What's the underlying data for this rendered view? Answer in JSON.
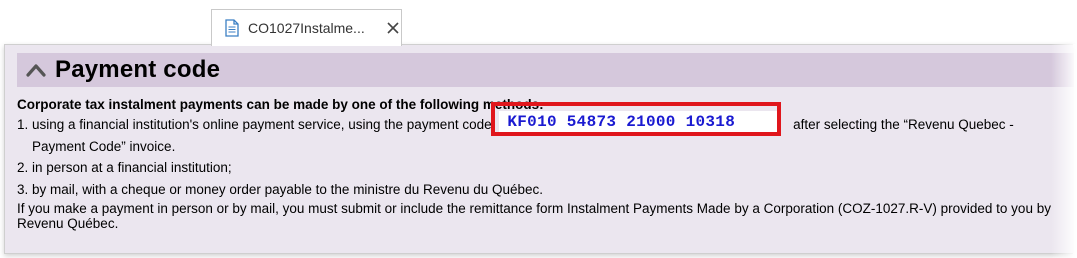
{
  "tab": {
    "title": "CO1027Instalme...",
    "file_icon": "document-icon",
    "close_icon": "close-icon"
  },
  "section": {
    "title": "Payment code",
    "toggle_icon": "chevron-up-icon"
  },
  "content": {
    "intro": "Corporate tax instalment payments can be made by one of the following methods:",
    "method1_prefix": "1. using a financial institution's online payment service, using the payment code",
    "payment_code": "KF010  54873  21000  10318",
    "method1_suffix": "after selecting the “Revenu Quebec -",
    "method1_cont": "Payment Code” invoice.",
    "method2": "2. in person at a financial institution;",
    "method3": "3. by mail, with a cheque or money order payable to the ministre du Revenu du Québec.",
    "note": "If you make a payment in person or by mail, you must submit or include the remittance form Instalment Payments Made by a Corporation (COZ-1027.R-V) provided to you by Revenu Québec."
  },
  "colors": {
    "header_bg": "#d5c8dc",
    "panel_bg": "#ebe6ef",
    "highlight": "#e0161c",
    "code_text": "#1a1ad1"
  }
}
